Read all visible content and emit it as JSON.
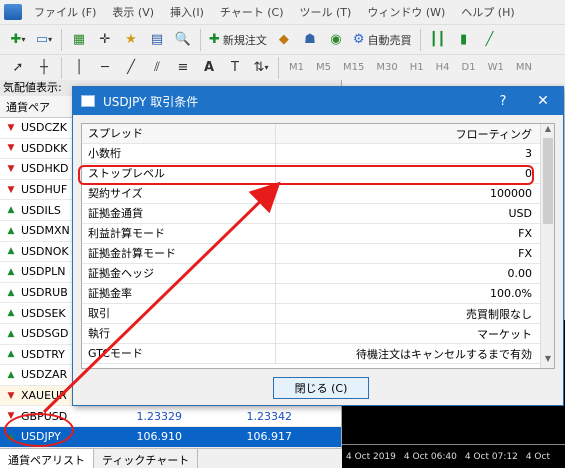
{
  "menu": [
    "ファイル (F)",
    "表示 (V)",
    "挿入(I)",
    "チャート (C)",
    "ツール (T)",
    "ウィンドウ (W)",
    "ヘルプ (H)"
  ],
  "toolbar": {
    "new_order": "新規注文",
    "auto_trade": "自動売買"
  },
  "timeframes": [
    "M1",
    "M5",
    "M15",
    "M30",
    "H1",
    "H4",
    "D1",
    "W1",
    "MN"
  ],
  "market_watch": {
    "title": "気配値表示:",
    "col_symbol": "通貨ペア",
    "rows": [
      {
        "sym": "USDCZK",
        "bid": "",
        "ask": ""
      },
      {
        "sym": "USDDKK",
        "bid": "",
        "ask": ""
      },
      {
        "sym": "USDHKD",
        "bid": "",
        "ask": ""
      },
      {
        "sym": "USDHUF",
        "bid": "",
        "ask": ""
      },
      {
        "sym": "USDILS",
        "bid": "",
        "ask": ""
      },
      {
        "sym": "USDMXN",
        "bid": "",
        "ask": ""
      },
      {
        "sym": "USDNOK",
        "bid": "",
        "ask": ""
      },
      {
        "sym": "USDPLN",
        "bid": "",
        "ask": ""
      },
      {
        "sym": "USDRUB",
        "bid": "",
        "ask": ""
      },
      {
        "sym": "USDSEK",
        "bid": "",
        "ask": ""
      },
      {
        "sym": "USDSGD",
        "bid": "",
        "ask": ""
      },
      {
        "sym": "USDTRY",
        "bid": "",
        "ask": ""
      },
      {
        "sym": "USDZAR",
        "bid": "",
        "ask": ""
      },
      {
        "sym": "XAUEUR",
        "bid": "",
        "ask": ""
      },
      {
        "sym": "GBPUSD",
        "bid": "1.23329",
        "ask": "1.23342"
      },
      {
        "sym": "USDJPY",
        "bid": "106.910",
        "ask": "106.917"
      }
    ],
    "tabs": [
      "通貨ペアリスト",
      "ティックチャート"
    ]
  },
  "chart_axis": [
    "4 Oct 2019",
    "4 Oct 06:40",
    "4 Oct 07:12",
    "4 Oct"
  ],
  "dialog": {
    "title": "USDJPY 取引条件",
    "help": "?",
    "close": "✕",
    "props": [
      {
        "k": "スプレッド",
        "v": "フローティング"
      },
      {
        "k": "小数桁",
        "v": "3"
      },
      {
        "k": "ストップレベル",
        "v": "0"
      },
      {
        "k": "契約サイズ",
        "v": "100000"
      },
      {
        "k": "証拠金通貨",
        "v": "USD"
      },
      {
        "k": "利益計算モード",
        "v": "FX"
      },
      {
        "k": "証拠金計算モード",
        "v": "FX"
      },
      {
        "k": "証拠金ヘッジ",
        "v": "0.00"
      },
      {
        "k": "証拠金率",
        "v": "100.0%"
      },
      {
        "k": "取引",
        "v": "売買制限なし"
      },
      {
        "k": "執行",
        "v": "マーケット"
      },
      {
        "k": "GTCモード",
        "v": "待機注文はキャンセルするまで有効"
      }
    ],
    "close_button": "閉じる (C)"
  }
}
